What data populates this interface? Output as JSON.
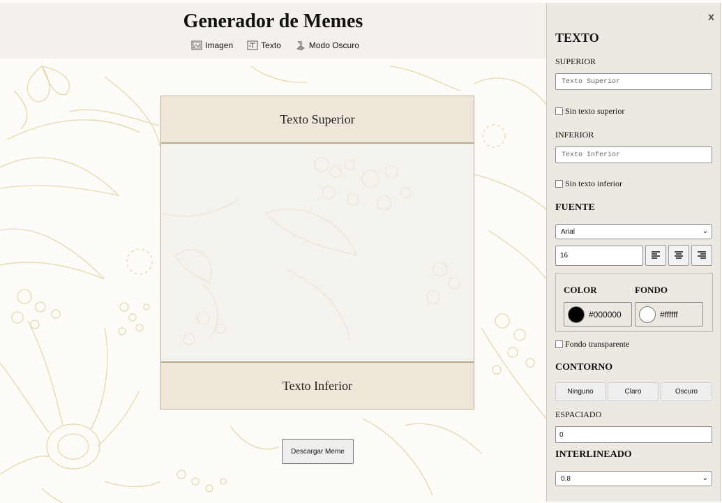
{
  "header": {
    "title": "Generador de Memes",
    "nav": [
      {
        "label": "Imagen",
        "icon": "image-icon"
      },
      {
        "label": "Texto",
        "icon": "text-icon"
      },
      {
        "label": "Modo Oscuro",
        "icon": "paint-icon"
      }
    ]
  },
  "meme": {
    "top_text": "Texto Superior",
    "bottom_text": "Texto Inferior"
  },
  "download_label": "Descargar Meme",
  "panel": {
    "close_label": "x",
    "title": "TEXTO",
    "top": {
      "label": "SUPERIOR",
      "placeholder": "Texto Superior",
      "value": "",
      "no_text_label": "Sin texto superior",
      "no_text_checked": false
    },
    "bottom": {
      "label": "INFERIOR",
      "placeholder": "Texto Inferior",
      "value": "",
      "no_text_label": "Sin texto inferior",
      "no_text_checked": false
    },
    "font": {
      "heading": "FUENTE",
      "family": "Arial",
      "size": "16",
      "align_options": [
        "left",
        "center",
        "right"
      ]
    },
    "color": {
      "heading": "COLOR",
      "value": "#000000",
      "swatch": "#000000"
    },
    "background": {
      "heading": "FONDO",
      "value": "#ffffff",
      "swatch": "#ffffff",
      "transparent_label": "Fondo transparente",
      "transparent_checked": false
    },
    "outline": {
      "heading": "CONTORNO",
      "options": [
        "Ninguno",
        "Claro",
        "Oscuro"
      ]
    },
    "spacing": {
      "label": "ESPACIADO",
      "value": "0"
    },
    "line_height": {
      "heading": "INTERLINEADO",
      "value": "0.8"
    }
  },
  "colors": {
    "header_bg": "#f4f1ec",
    "meme_band": "#efe7d9",
    "floral_stroke": "#e6d4a8",
    "panel_bg": "#ece7df"
  }
}
